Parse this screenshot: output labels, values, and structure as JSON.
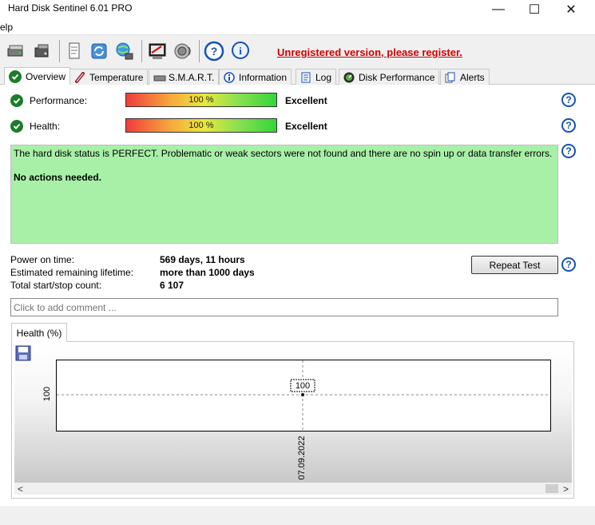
{
  "window": {
    "title": "Hard Disk Sentinel 6.01 PRO",
    "minimize_glyph": "—",
    "maximize_glyph": "☐",
    "close_glyph": "✕"
  },
  "menu": {
    "help_label": "elp"
  },
  "toolbar": {
    "icons": [
      "disk-icon",
      "disk-icon",
      "report-icon",
      "refresh-icon",
      "network-icon",
      "test-icon",
      "sound-icon",
      "help-icon",
      "info-icon"
    ],
    "register_text": "Unregistered version, please register."
  },
  "tabs": [
    {
      "label": "Overview",
      "icon": "check-icon",
      "active": true
    },
    {
      "label": "Temperature",
      "icon": "thermometer-icon"
    },
    {
      "label": "S.M.A.R.T.",
      "icon": "disk-icon"
    },
    {
      "label": "Information",
      "icon": "info-icon"
    },
    {
      "label": "Log",
      "icon": "log-icon"
    },
    {
      "label": "Disk Performance",
      "icon": "gauge-icon"
    },
    {
      "label": "Alerts",
      "icon": "alerts-icon"
    }
  ],
  "overview": {
    "performance": {
      "label": "Performance:",
      "value": "100 %",
      "percent": 100,
      "rating": "Excellent"
    },
    "health": {
      "label": "Health:",
      "value": "100 %",
      "percent": 100,
      "rating": "Excellent"
    },
    "status_message": "The hard disk status is PERFECT. Problematic or weak sectors were not found and there are no spin up or data transfer errors.",
    "status_action": "No actions needed.",
    "power_on": {
      "label": "Power on time:",
      "value": "569 days, 11 hours"
    },
    "lifetime": {
      "label": "Estimated remaining lifetime:",
      "value": "more than 1000 days"
    },
    "start_stop": {
      "label": "Total start/stop count:",
      "value": "6 107"
    },
    "repeat_test_label": "Repeat Test",
    "comment_placeholder": "Click to add comment ...",
    "help_glyph": "?",
    "graph_tab_label": "Health (%)"
  },
  "chart_data": {
    "type": "line",
    "x": [
      "07.09.2022"
    ],
    "series": [
      {
        "values": [
          100
        ]
      }
    ],
    "ylabel": "",
    "xlabel": "",
    "ytick_labels": [
      "100"
    ],
    "xtick_labels": [
      "07.09.2022"
    ],
    "data_labels": [
      "100"
    ],
    "grid": true
  },
  "scrollbar": {
    "left_glyph": "<",
    "right_glyph": ">"
  }
}
